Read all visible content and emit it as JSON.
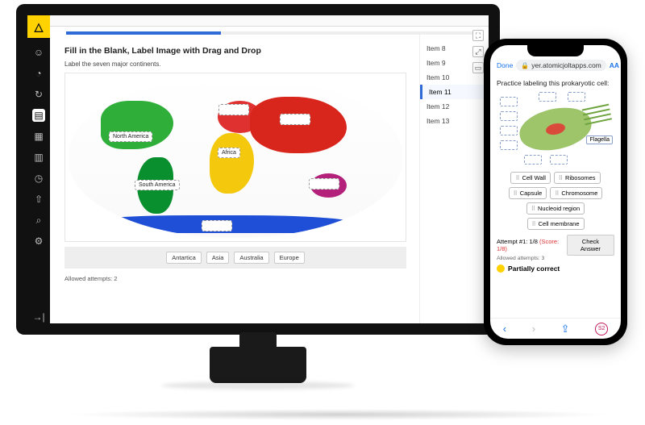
{
  "desktop": {
    "rail": {
      "logo_glyph": "△",
      "icons": [
        "user",
        "clock",
        "refresh",
        "doc",
        "grid",
        "clipboard",
        "time",
        "upload",
        "search",
        "settings"
      ],
      "active_index": 3,
      "collapse_glyph": "→|"
    },
    "question": {
      "title": "Fill in the Blank, Label Image with Drag and Drop",
      "subtitle": "Label the seven major continents.",
      "placed_labels": {
        "north_america": "North America",
        "south_america": "South America",
        "africa": "Africa"
      },
      "chips": [
        "Antartica",
        "Asia",
        "Australia",
        "Europe"
      ],
      "attempts_label": "Allowed attempts:",
      "attempts_value": "2"
    },
    "items": {
      "list": [
        "Item 8",
        "Item 9",
        "Item 10",
        "Item 11",
        "Item 12",
        "Item 13"
      ],
      "active_index": 3
    },
    "panel_icons": [
      "⛶",
      "⤢",
      "▭"
    ]
  },
  "phone": {
    "urlbar": {
      "done": "Done",
      "host": "yer.atomicjoltapps.com",
      "aa": "AA",
      "reload": "↻"
    },
    "prompt": "Practice labeling this prokaryotic cell:",
    "placed_label": "Flagella",
    "chips": [
      "Cell Wall",
      "Ribosomes",
      "Capsule",
      "Chromosome",
      "Nucleoid region",
      "Cell membrane"
    ],
    "attempt": {
      "label": "Attempt #1:",
      "progress": "1/8",
      "score_label": "(Score: 1/8)",
      "check": "Check Answer",
      "allowed_label": "Allowed attempts:",
      "allowed_value": "3",
      "result": "Partially correct"
    },
    "nav": {
      "back": "‹",
      "fwd": "›",
      "share": "⇪",
      "s2": "S2"
    }
  }
}
